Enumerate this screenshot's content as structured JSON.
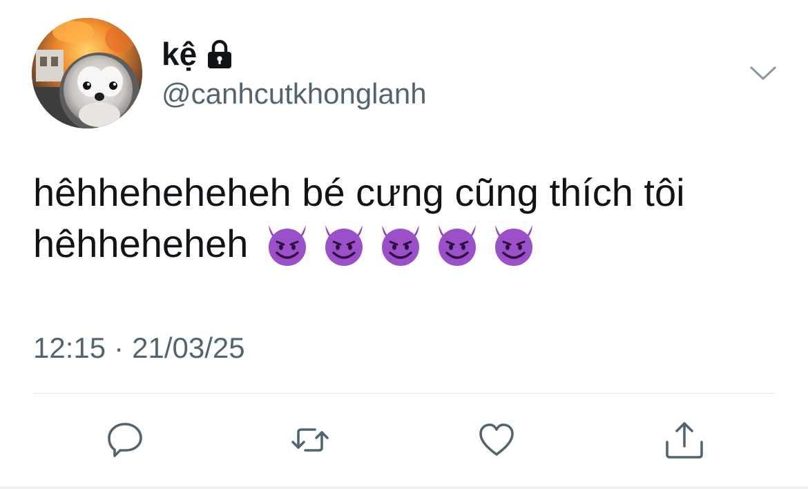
{
  "author": {
    "display_name": "kệ",
    "handle": "@canhcutkhonglanh",
    "avatar_icon": "penguin-on-fire-avatar",
    "protected_icon": "lock-icon"
  },
  "tweet": {
    "line1": "hêhheheheheh bé cưng cũng thích tôi",
    "line2": "hêhheheheh",
    "emojis": [
      "smiling-devil-icon",
      "smiling-devil-icon",
      "smiling-devil-icon",
      "smiling-devil-icon",
      "smiling-devil-icon"
    ],
    "time": "12:15",
    "separator": "·",
    "date": "21/03/25"
  },
  "actions": [
    {
      "name": "reply",
      "icon": "speech-bubble-icon"
    },
    {
      "name": "retweet",
      "icon": "retweet-arrows-icon"
    },
    {
      "name": "like",
      "icon": "heart-icon"
    },
    {
      "name": "share",
      "icon": "share-upload-icon"
    }
  ],
  "colors": {
    "text_primary": "#0f1419",
    "text_secondary": "#536471",
    "divider": "#e7e9ea",
    "emoji_purple": "#9b4fc9"
  }
}
